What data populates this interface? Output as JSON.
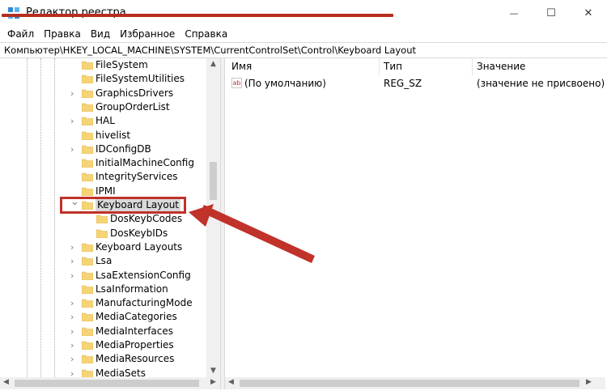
{
  "window": {
    "title": "Редактор реестра",
    "minimize_glyph": "—",
    "maximize_glyph": "☐",
    "close_glyph": "✕"
  },
  "menu": [
    "Файл",
    "Правка",
    "Вид",
    "Избранное",
    "Справка"
  ],
  "address": "Компьютер\\HKEY_LOCAL_MACHINE\\SYSTEM\\CurrentControlSet\\Control\\Keyboard Layout",
  "tree": [
    {
      "label": "FileSystem",
      "expander": "",
      "indent": 0
    },
    {
      "label": "FileSystemUtilities",
      "expander": "",
      "indent": 0
    },
    {
      "label": "GraphicsDrivers",
      "expander": ">",
      "indent": 0
    },
    {
      "label": "GroupOrderList",
      "expander": "",
      "indent": 0
    },
    {
      "label": "HAL",
      "expander": ">",
      "indent": 0
    },
    {
      "label": "hivelist",
      "expander": "",
      "indent": 0
    },
    {
      "label": "IDConfigDB",
      "expander": ">",
      "indent": 0
    },
    {
      "label": "InitialMachineConfig",
      "expander": "",
      "indent": 0
    },
    {
      "label": "IntegrityServices",
      "expander": "",
      "indent": 0
    },
    {
      "label": "IPMI",
      "expander": "",
      "indent": 0
    },
    {
      "label": "Keyboard Layout",
      "expander": "v",
      "indent": 0,
      "selected": true
    },
    {
      "label": "DosKeybCodes",
      "expander": "",
      "indent": 1
    },
    {
      "label": "DosKeybIDs",
      "expander": "",
      "indent": 1
    },
    {
      "label": "Keyboard Layouts",
      "expander": ">",
      "indent": 0
    },
    {
      "label": "Lsa",
      "expander": ">",
      "indent": 0
    },
    {
      "label": "LsaExtensionConfig",
      "expander": ">",
      "indent": 0
    },
    {
      "label": "LsaInformation",
      "expander": "",
      "indent": 0
    },
    {
      "label": "ManufacturingMode",
      "expander": ">",
      "indent": 0
    },
    {
      "label": "MediaCategories",
      "expander": ">",
      "indent": 0
    },
    {
      "label": "MediaInterfaces",
      "expander": ">",
      "indent": 0
    },
    {
      "label": "MediaProperties",
      "expander": ">",
      "indent": 0
    },
    {
      "label": "MediaResources",
      "expander": ">",
      "indent": 0
    },
    {
      "label": "MediaSets",
      "expander": ">",
      "indent": 0
    }
  ],
  "columns": {
    "name": "Имя",
    "type": "Тип",
    "value": "Значение"
  },
  "values": [
    {
      "icon_text": "ab",
      "name": "(По умолчанию)",
      "type": "REG_SZ",
      "data": "(значение не присвоено)"
    }
  ],
  "colors": {
    "annotation": "#c0322a",
    "folder": "#f5d476",
    "window_border": "#1ba1e2"
  }
}
